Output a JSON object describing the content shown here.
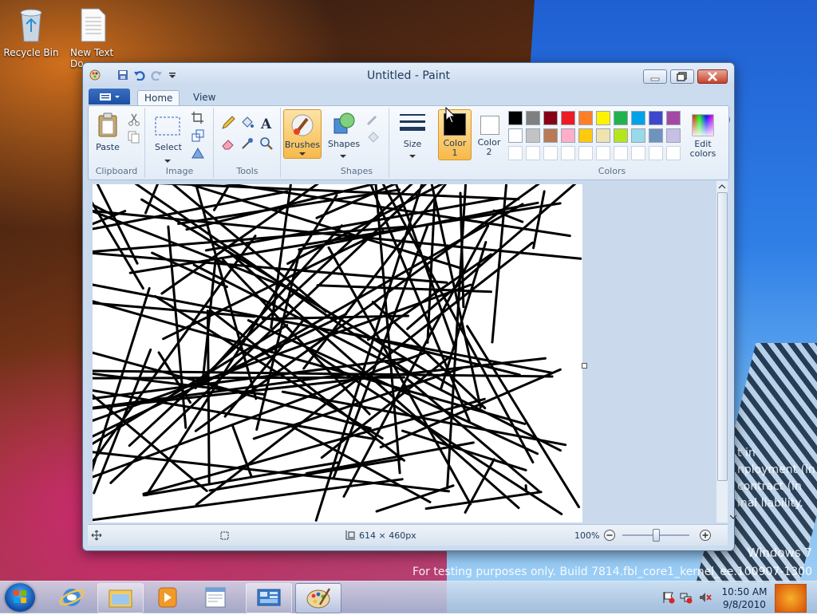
{
  "desktop": {
    "icons": [
      {
        "label": "Recycle Bin"
      },
      {
        "label": "New Text Do"
      }
    ],
    "watermark": {
      "partial_lines": [
        "t in",
        "nployment (in",
        "contract (in",
        "inal liability."
      ],
      "windows_label": "Windows 7",
      "build_label": "For testing purposes only. Build 7814.fbl_core1_kernel_ee.100907-1300"
    }
  },
  "paint": {
    "title": "Untitled - Paint",
    "tabs": [
      {
        "label": "Home"
      },
      {
        "label": "View"
      }
    ],
    "ribbon": {
      "clipboard": {
        "paste_label": "Paste",
        "group_label": "Clipboard"
      },
      "image": {
        "select_label": "Select",
        "group_label": "Image"
      },
      "tools": {
        "group_label": "Tools"
      },
      "brushes": {
        "label": "Brushes"
      },
      "shapes": {
        "label": "Shapes",
        "group_label": "Shapes"
      },
      "size": {
        "label": "Size"
      },
      "color1": {
        "label": "Color",
        "number": "1",
        "value": "#000000"
      },
      "color2": {
        "label": "Color",
        "number": "2",
        "value": "#ffffff"
      },
      "colors": {
        "group_label": "Colors",
        "edit_label": "Edit",
        "edit_label2": "colors",
        "row1": [
          "#000000",
          "#7f7f7f",
          "#880015",
          "#ed1c24",
          "#ff7f27",
          "#fff200",
          "#22b14c",
          "#00a2e8",
          "#3f48cc",
          "#a349a4"
        ],
        "row2": [
          "#ffffff",
          "#c3c3c3",
          "#b97a57",
          "#ffaec9",
          "#ffc90e",
          "#efe4b0",
          "#b5e61d",
          "#99d9ea",
          "#7092be",
          "#c8bfe7"
        ],
        "row3": [
          "#ffffff",
          "#ffffff",
          "#ffffff",
          "#ffffff",
          "#ffffff",
          "#ffffff",
          "#ffffff",
          "#ffffff",
          "#ffffff",
          "#ffffff"
        ]
      }
    },
    "status": {
      "canvas_size": "614 × 460px",
      "zoom": "100%"
    }
  },
  "taskbar": {
    "clock_time": "10:50 AM",
    "clock_date": "9/8/2010"
  }
}
